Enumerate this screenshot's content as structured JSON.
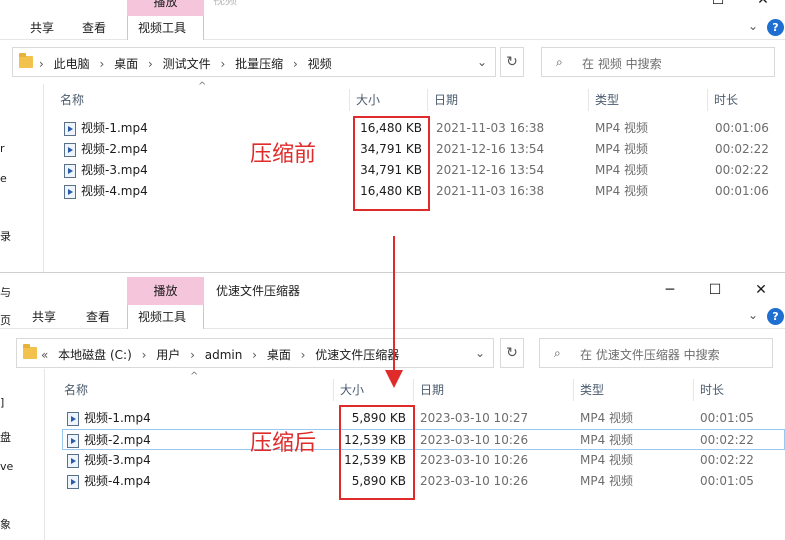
{
  "windows": [
    {
      "title": "",
      "ribbon": {
        "tab_share": "共享",
        "tab_view": "查看",
        "tab_context": "视频工具",
        "context_header": "播放",
        "faded_header": "视频"
      },
      "breadcrumbs": [
        "此电脑",
        "桌面",
        "测试文件",
        "批量压缩",
        "视频"
      ],
      "search_placeholder": "在 视频 中搜索",
      "columns": {
        "name": "名称",
        "size": "大小",
        "date": "日期",
        "type": "类型",
        "duration": "时长"
      },
      "nav_fragments": [
        "r",
        "e",
        "录"
      ],
      "files": [
        {
          "name": "视频-1.mp4",
          "size": "16,480 KB",
          "date": "2021-11-03 16:38",
          "type": "MP4 视频",
          "duration": "00:01:06"
        },
        {
          "name": "视频-2.mp4",
          "size": "34,791 KB",
          "date": "2021-12-16 13:54",
          "type": "MP4 视频",
          "duration": "00:02:22"
        },
        {
          "name": "视频-3.mp4",
          "size": "34,791 KB",
          "date": "2021-12-16 13:54",
          "type": "MP4 视频",
          "duration": "00:02:22"
        },
        {
          "name": "视频-4.mp4",
          "size": "16,480 KB",
          "date": "2021-11-03 16:38",
          "type": "MP4 视频",
          "duration": "00:01:06"
        }
      ],
      "annotation": "压缩前"
    },
    {
      "title": "优速文件压缩器",
      "ribbon": {
        "tab_share": "共享",
        "tab_view": "查看",
        "tab_context": "视频工具",
        "context_header": "播放"
      },
      "breadcrumbs": [
        "本地磁盘 (C:)",
        "用户",
        "admin",
        "桌面",
        "优速文件压缩器"
      ],
      "search_placeholder": "在 优速文件压缩器 中搜索",
      "columns": {
        "name": "名称",
        "size": "大小",
        "date": "日期",
        "type": "类型",
        "duration": "时长"
      },
      "nav_fragments": [
        "与",
        "页",
        "]",
        "盘",
        "ve",
        "象"
      ],
      "files": [
        {
          "name": "视频-1.mp4",
          "size": "5,890 KB",
          "date": "2023-03-10 10:27",
          "type": "MP4 视频",
          "duration": "00:01:05"
        },
        {
          "name": "视频-2.mp4",
          "size": "12,539 KB",
          "date": "2023-03-10 10:26",
          "type": "MP4 视频",
          "duration": "00:02:22"
        },
        {
          "name": "视频-3.mp4",
          "size": "12,539 KB",
          "date": "2023-03-10 10:26",
          "type": "MP4 视频",
          "duration": "00:02:22"
        },
        {
          "name": "视频-4.mp4",
          "size": "5,890 KB",
          "date": "2023-03-10 10:26",
          "type": "MP4 视频",
          "duration": "00:01:05"
        }
      ],
      "annotation": "压缩后"
    }
  ],
  "icons": {
    "minimize": "─",
    "maximize": "☐",
    "close": "✕",
    "back_nav": "‹",
    "history": "«",
    "breadcrumb_sep": "›",
    "dropdown": "⌄",
    "refresh": "↻",
    "search": "⌕",
    "sort_up": "^",
    "collapse_ribbon": "⌄",
    "help": "?"
  },
  "colors": {
    "annotation_red": "#e02b2b",
    "context_tab_pink": "#f5c5dc",
    "selection_blue": "#99c9ef"
  }
}
